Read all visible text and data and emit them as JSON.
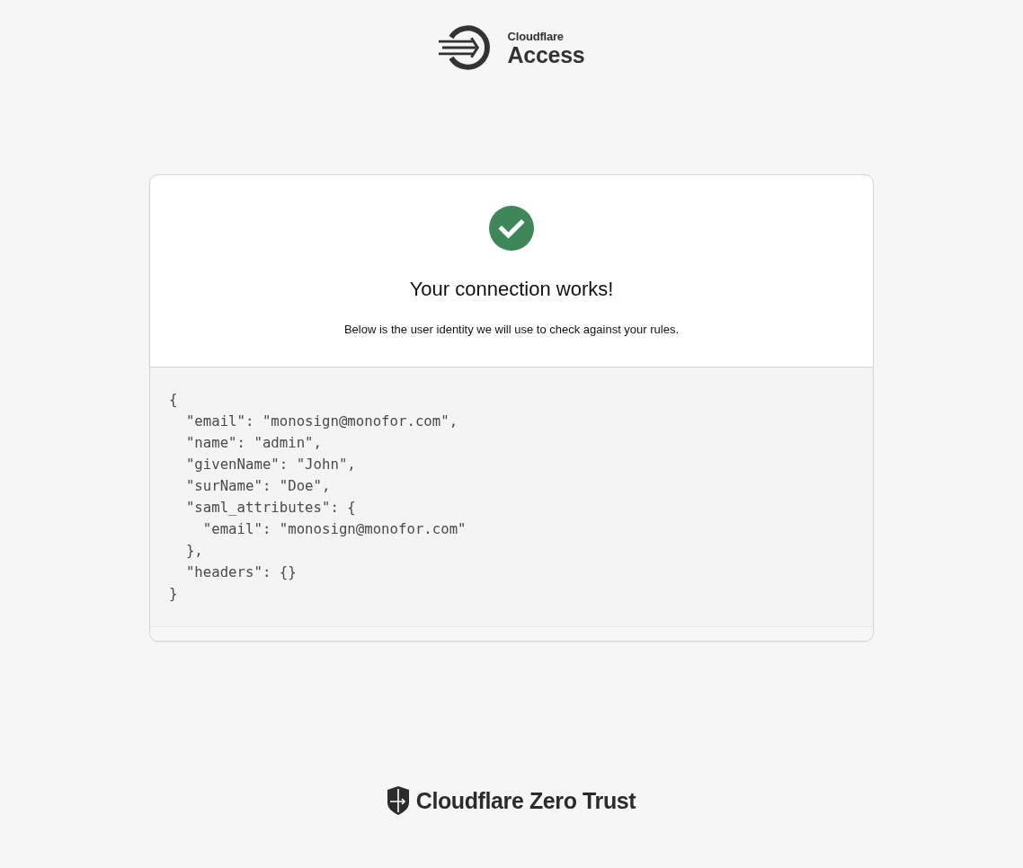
{
  "header": {
    "brand": "Cloudflare",
    "product": "Access"
  },
  "card": {
    "success": true,
    "title": "Your connection works!",
    "message": "Below is the user identity we will use to check against your rules.",
    "identity_lines": [
      "{",
      "  \"email\": \"monosign@monofor.com\",",
      "  \"name\": \"admin\",",
      "  \"givenName\": \"John\",",
      "  \"surName\": \"Doe\",",
      "  \"saml_attributes\": {",
      "    \"email\": \"monosign@monofor.com\"",
      "  },",
      "  \"headers\": {}",
      "}"
    ]
  },
  "footer": {
    "brand": "Cloudflare Zero Trust"
  }
}
